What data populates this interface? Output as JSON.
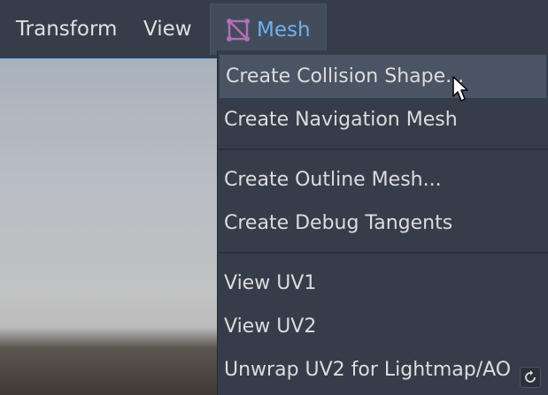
{
  "menubar": {
    "items": [
      {
        "label": "Transform"
      },
      {
        "label": "View"
      },
      {
        "label": "Mesh",
        "active": true,
        "icon": "mesh-icon"
      }
    ]
  },
  "mesh_menu": {
    "items": [
      {
        "label": "Create Collision Shape..."
      },
      {
        "label": "Create Navigation Mesh"
      },
      {
        "label": "Create Outline Mesh..."
      },
      {
        "label": "Create Debug Tangents"
      },
      {
        "label": "View UV1"
      },
      {
        "label": "View UV2"
      },
      {
        "label": "Unwrap UV2 for Lightmap/AO"
      }
    ]
  },
  "colors": {
    "panel_bg": "#363d4a",
    "accent": "#6fb0ee",
    "hover_bg": "#4b5464",
    "text": "#dcdcdc"
  }
}
